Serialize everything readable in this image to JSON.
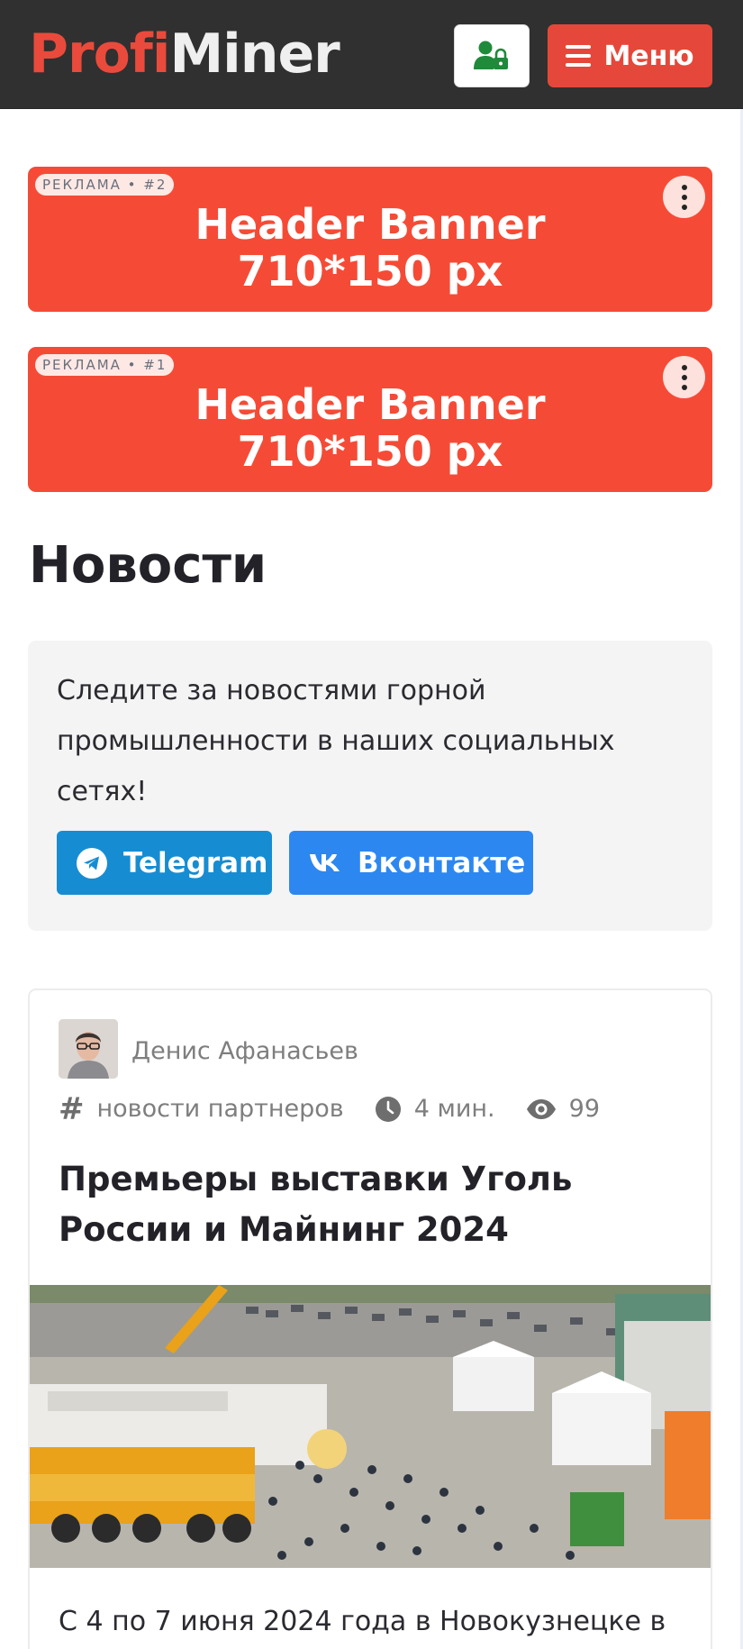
{
  "header": {
    "logo_part1": "Profi",
    "logo_part2": "Miner",
    "menu_label": "Меню",
    "login_icon": "user-lock-icon",
    "menu_icon": "hamburger-icon",
    "colors": {
      "background": "#303030",
      "brand": "#e5483a",
      "login_icon": "#1f8a3a"
    }
  },
  "banners": [
    {
      "tag": "РЕКЛАМА • #2",
      "line1": "Header Banner",
      "line2": "710*150 px"
    },
    {
      "tag": "РЕКЛАМА • #1",
      "line1": "Header Banner",
      "line2": "710*150 px"
    }
  ],
  "page": {
    "title": "Новости"
  },
  "social": {
    "text": "Следите за новостями горной промышленности в наших социальных сетях!",
    "telegram_label": "Telegram",
    "vk_label": "Вконтакте",
    "colors": {
      "telegram": "#168dd2",
      "vk": "#2d87f0"
    }
  },
  "article": {
    "author": "Денис Афанасьев",
    "category": "новости партнеров",
    "read_time": "4 мин.",
    "views": "99",
    "title": "Премьеры выставки Уголь России и Майнинг 2024",
    "excerpt": "С 4 по 7 июня 2024 года в Новокузнецке в"
  }
}
